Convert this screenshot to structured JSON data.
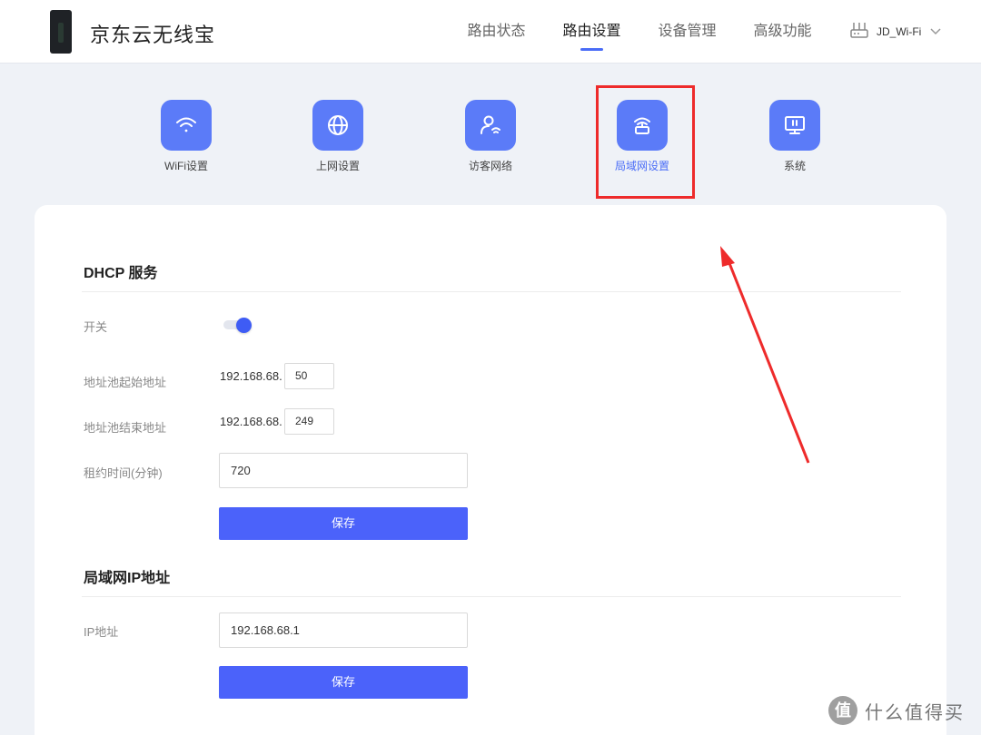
{
  "header": {
    "brand": "京东云无线宝",
    "nav": [
      {
        "label": "路由状态",
        "active": false
      },
      {
        "label": "路由设置",
        "active": true
      },
      {
        "label": "设备管理",
        "active": false
      },
      {
        "label": "高级功能",
        "active": false
      }
    ],
    "router_ssid": "JD_Wi-Fi"
  },
  "categories": [
    {
      "label": "WiFi设置",
      "icon": "wifi-icon",
      "active": false
    },
    {
      "label": "上网设置",
      "icon": "globe-icon",
      "active": false
    },
    {
      "label": "访客网络",
      "icon": "guest-user-icon",
      "active": false
    },
    {
      "label": "局域网设置",
      "icon": "lan-router-icon",
      "active": true
    },
    {
      "label": "系统",
      "icon": "monitor-icon",
      "active": false
    }
  ],
  "dhcp": {
    "title": "DHCP 服务",
    "switch_label": "开关",
    "switch_on": true,
    "pool_start_label": "地址池起始地址",
    "pool_start_prefix": "192.168.68.",
    "pool_start_value": "50",
    "pool_end_label": "地址池结束地址",
    "pool_end_prefix": "192.168.68.",
    "pool_end_value": "249",
    "lease_label": "租约时间(分钟)",
    "lease_value": "720",
    "save_label": "保存"
  },
  "lan_ip": {
    "title": "局域网IP地址",
    "ip_label": "IP地址",
    "ip_value": "192.168.68.1",
    "save_label": "保存"
  },
  "watermark": {
    "mark": "值",
    "text": "什么值得买"
  },
  "colors": {
    "accent": "#4b62fa",
    "tile": "#5b7bf8",
    "annotation": "#ee2b2b",
    "background": "#eff2f7"
  }
}
